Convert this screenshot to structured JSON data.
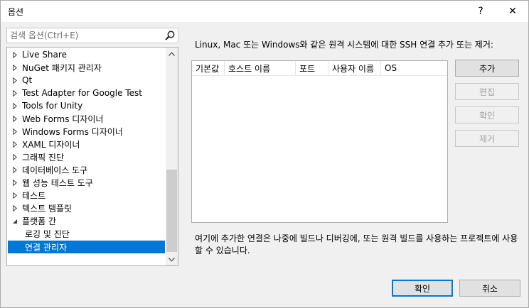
{
  "window": {
    "title": "옵션",
    "help_glyph": "?",
    "close_glyph": "✕"
  },
  "search": {
    "placeholder": "검색 옵션(Ctrl+E)"
  },
  "tree": {
    "items": [
      {
        "label": "Live Share",
        "expandable": true
      },
      {
        "label": "NuGet 패키지 관리자",
        "expandable": true
      },
      {
        "label": "Qt",
        "expandable": true
      },
      {
        "label": "Test Adapter for Google Test",
        "expandable": true
      },
      {
        "label": "Tools for Unity",
        "expandable": true
      },
      {
        "label": "Web Forms 디자이너",
        "expandable": true
      },
      {
        "label": "Windows Forms 디자이너",
        "expandable": true
      },
      {
        "label": "XAML 디자이너",
        "expandable": true
      },
      {
        "label": "그래픽 진단",
        "expandable": true
      },
      {
        "label": "데이터베이스 도구",
        "expandable": true
      },
      {
        "label": "웹 성능 테스트 도구",
        "expandable": true
      },
      {
        "label": "테스트",
        "expandable": true
      },
      {
        "label": "텍스트 템플릿",
        "expandable": true
      },
      {
        "label": "플랫폼 간",
        "expanded": true
      },
      {
        "label": "로깅 및 진단",
        "child": true
      },
      {
        "label": "연결 관리자",
        "child": true,
        "selected": true
      }
    ]
  },
  "main": {
    "description": "Linux, Mac 또는 Windows와 같은 원격 시스템에 대한 SSH 연결 추가 또는 제거:",
    "columns": [
      "기본값",
      "호스트 이름",
      "포트",
      "사용자 이름",
      "OS"
    ],
    "buttons": {
      "add": "추가",
      "edit": "편집",
      "verify": "확인",
      "remove": "제거"
    },
    "note": "여기에 추가한 연결은 나중에 빌드나 디버깅에, 또는 원격 빌드를 사용하는 프로젝트에 사용할 수 있습니다."
  },
  "footer": {
    "ok": "확인",
    "cancel": "취소"
  },
  "colors": {
    "selection": "#0078d7",
    "dialog_bg": "#f0f0f0"
  }
}
